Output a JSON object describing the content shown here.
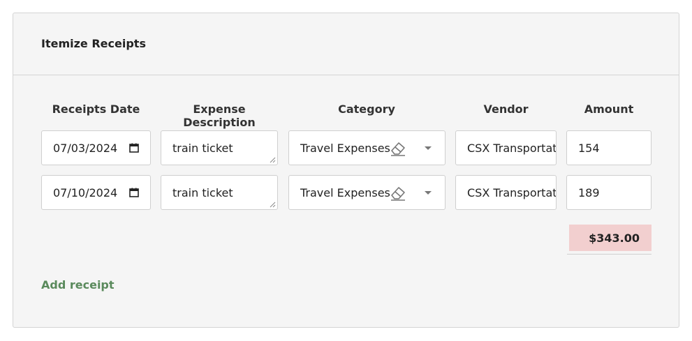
{
  "panel": {
    "title": "Itemize Receipts"
  },
  "columns": {
    "date": "Receipts Date",
    "description": "Expense Description",
    "category": "Category",
    "vendor": "Vendor",
    "amount": "Amount"
  },
  "rows": [
    {
      "date": "07/03/2024",
      "description": "train ticket",
      "category": "Travel Expenses",
      "vendor": "CSX Transportation",
      "amount": "154"
    },
    {
      "date": "07/10/2024",
      "description": "train ticket",
      "category": "Travel Expenses",
      "vendor": "CSX Transportation",
      "amount": "189"
    }
  ],
  "total": "$343.00",
  "add_receipt_label": "Add receipt",
  "colors": {
    "panel_bg": "#f5f5f5",
    "total_bg": "#f2cfcf",
    "link": "#5a8a5c"
  },
  "icons": {
    "date": "calendar-icon",
    "category_clear": "eraser-icon",
    "category_dropdown": "caret-down-icon",
    "textarea": "resize-grip-icon"
  }
}
